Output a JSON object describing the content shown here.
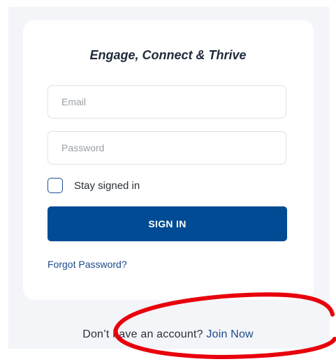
{
  "login": {
    "title": "Engage, Connect & Thrive",
    "email_placeholder": "Email",
    "password_placeholder": "Password",
    "stay_signed_in_label": "Stay signed in",
    "stay_signed_in_checked": false,
    "sign_in_label": "SIGN IN",
    "forgot_password_label": "Forgot Password?"
  },
  "footer": {
    "prompt": "Don’t have an account?",
    "join_label": "Join Now"
  },
  "colors": {
    "primary": "#004b93",
    "link": "#1c4b8a",
    "page_background": "#f3f5f9",
    "annotation_circle": "#e8000b"
  }
}
